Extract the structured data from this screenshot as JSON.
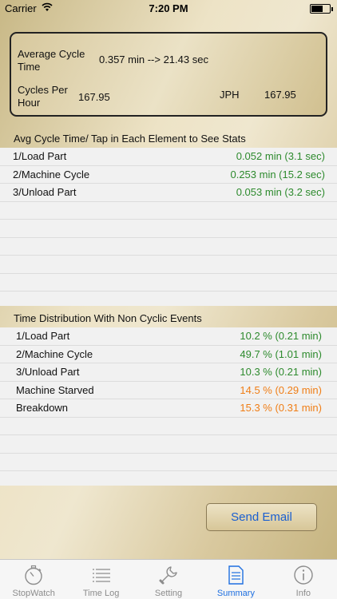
{
  "status_bar": {
    "carrier": "Carrier",
    "time": "7:20 PM"
  },
  "summary": {
    "avg_cycle_label": "Average Cycle Time",
    "avg_cycle_value": "0.357 min --> 21.43 sec",
    "cycles_per_hour_label": "Cycles Per Hour",
    "cycles_per_hour_value": "167.95",
    "jph_label": "JPH",
    "jph_value": "167.95"
  },
  "cycle_section": {
    "header": "Avg Cycle Time/ Tap in Each Element to See Stats",
    "rows": [
      {
        "name": "1/Load Part",
        "value": "0.052 min (3.1 sec)"
      },
      {
        "name": "2/Machine Cycle",
        "value": "0.253 min (15.2 sec)"
      },
      {
        "name": "3/Unload Part",
        "value": "0.053 min (3.2 sec)"
      }
    ]
  },
  "distribution_section": {
    "header": "Time Distribution With Non  Cyclic Events",
    "rows": [
      {
        "name": "1/Load Part",
        "value": "10.2 % (0.21 min)",
        "color": "#2d8a2d"
      },
      {
        "name": "2/Machine Cycle",
        "value": "49.7 % (1.01 min)",
        "color": "#2d8a2d"
      },
      {
        "name": "3/Unload Part",
        "value": "10.3 % (0.21 min)",
        "color": "#2d8a2d"
      },
      {
        "name": "Machine Starved",
        "value": "14.5 % (0.29 min)",
        "color": "#f07e16"
      },
      {
        "name": "Breakdown",
        "value": "15.3 % (0.31 min)",
        "color": "#f07e16"
      }
    ]
  },
  "send_email_label": "Send Email",
  "tabs": [
    {
      "label": "StopWatch",
      "icon": "stopwatch-icon"
    },
    {
      "label": "Time Log",
      "icon": "list-icon"
    },
    {
      "label": "Setting",
      "icon": "wrench-icon"
    },
    {
      "label": "Summary",
      "icon": "document-icon",
      "active": true
    },
    {
      "label": "Info",
      "icon": "info-icon"
    }
  ]
}
